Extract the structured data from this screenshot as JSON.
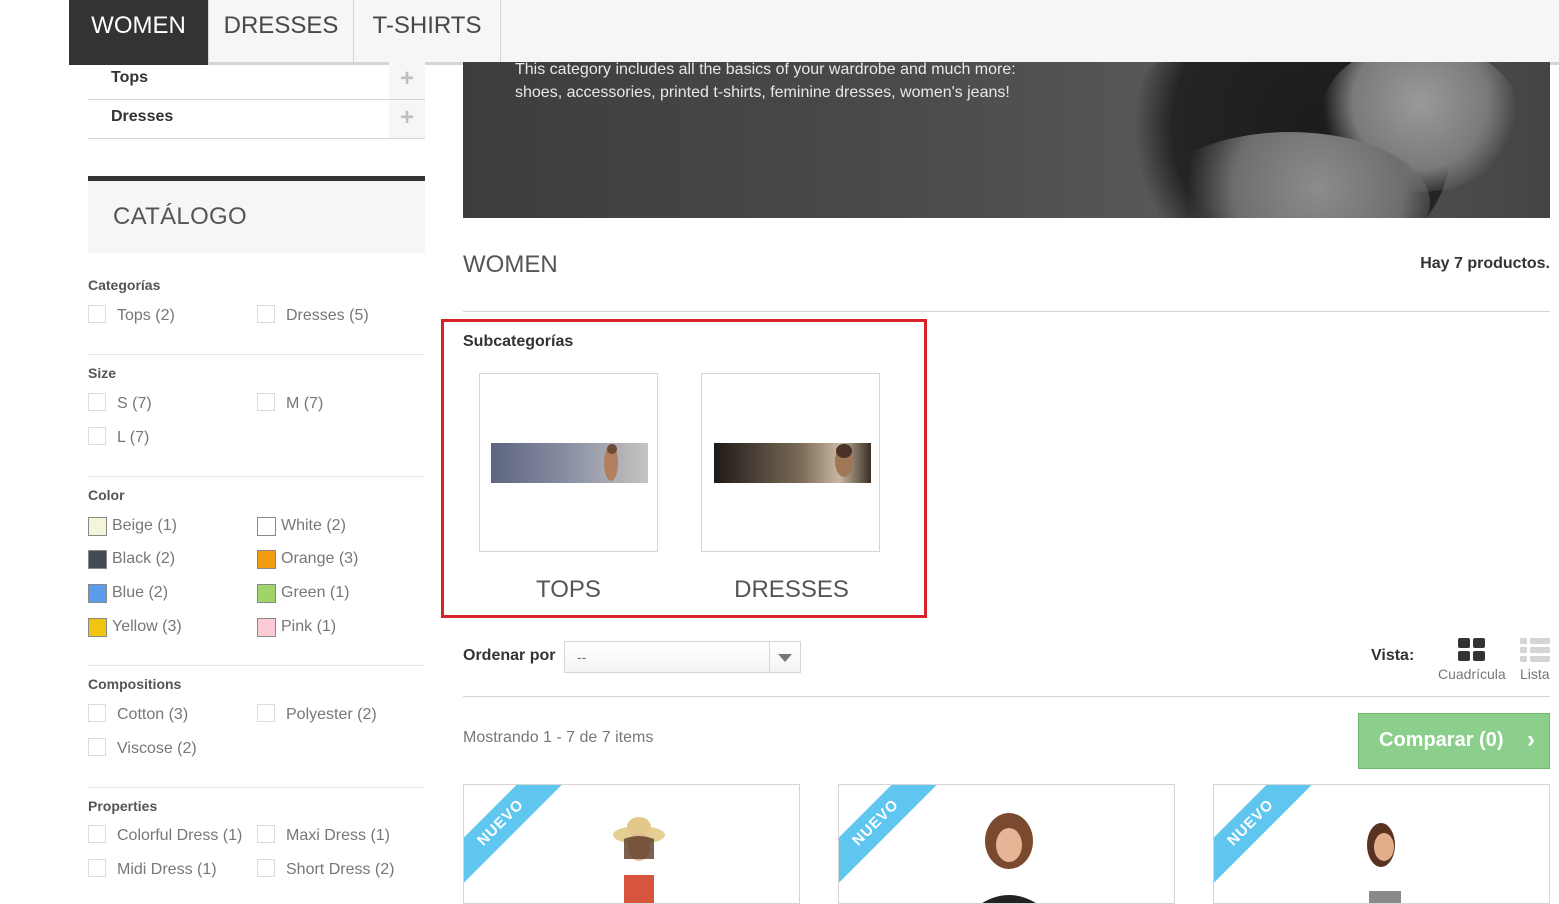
{
  "topnav": {
    "tabs": [
      {
        "label": "WOMEN"
      },
      {
        "label": "DRESSES"
      },
      {
        "label": "T-SHIRTS"
      }
    ]
  },
  "sidebar": {
    "subcategories": [
      {
        "label": "Tops"
      },
      {
        "label": "Dresses"
      }
    ],
    "catalog_title": "CATÁLOGO",
    "filters": {
      "categories": {
        "title": "Categorías",
        "items": [
          "Tops (2)",
          "Dresses (5)"
        ]
      },
      "size": {
        "title": "Size",
        "items": [
          "S (7)",
          "M (7)",
          "L (7)"
        ]
      },
      "color": {
        "title": "Color",
        "items": [
          {
            "label": "Beige (1)",
            "color": "#f5f5dc"
          },
          {
            "label": "White (2)",
            "color": "#ffffff"
          },
          {
            "label": "Black (2)",
            "color": "#434a54"
          },
          {
            "label": "Orange (3)",
            "color": "#f39c11"
          },
          {
            "label": "Blue (2)",
            "color": "#5d9cec"
          },
          {
            "label": "Green (1)",
            "color": "#a0d468"
          },
          {
            "label": "Yellow (3)",
            "color": "#f1c40f"
          },
          {
            "label": "Pink (1)",
            "color": "#fcccd6"
          }
        ]
      },
      "compositions": {
        "title": "Compositions",
        "items": [
          "Cotton (3)",
          "Polyester (2)",
          "Viscose (2)"
        ]
      },
      "properties": {
        "title": "Properties",
        "items": [
          "Colorful Dress (1)",
          "Maxi Dress (1)",
          "Midi Dress (1)",
          "Short Dress (2)"
        ]
      }
    }
  },
  "banner": {
    "line1": "This category includes all the basics of your wardrobe and much more:",
    "line2": "shoes, accessories, printed t-shirts, feminine dresses, women's jeans!"
  },
  "main": {
    "heading": "WOMEN",
    "product_count": "Hay 7 productos.",
    "subcategories": {
      "title": "Subcategorías",
      "items": [
        {
          "name": "TOPS"
        },
        {
          "name": "DRESSES"
        }
      ]
    },
    "sort": {
      "label": "Ordenar por",
      "value": "--"
    },
    "view": {
      "label": "Vista:",
      "grid": "Cuadrícula",
      "list": "Lista"
    },
    "showing": "Mostrando 1 - 7 de 7 items",
    "compare_button": "Comparar (0)",
    "product_badges": [
      "NUEVO",
      "NUEVO",
      "NUEVO"
    ]
  },
  "colors": {
    "accent_highlight": "#d8232a",
    "compare_green": "#8ccf8c",
    "badge_blue": "#5fc6f0"
  }
}
